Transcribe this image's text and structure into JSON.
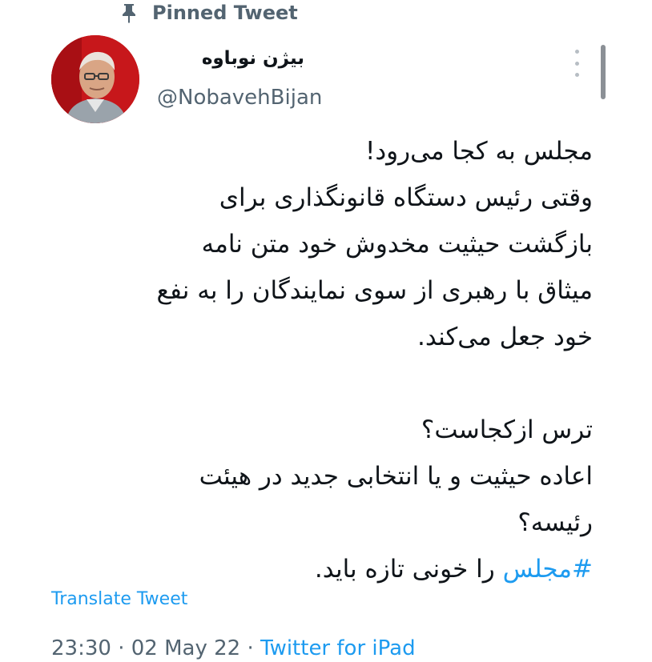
{
  "pinned": {
    "label": "Pinned Tweet"
  },
  "author": {
    "name": "بیژن نوباوه",
    "handle": "@NobavehBijan"
  },
  "tweet": {
    "lines_p1": [
      "مجلس به کجا می‌رود!",
      "وقتی رئیس دستگاه قانونگذاری برای",
      "بازگشت حیثیت مخدوش خود متن نامه",
      "میثاق با رهبری از سوی نمایندگان را به نفع",
      "خود جعل می‌کند."
    ],
    "lines_p2": [
      "ترس ازکجاست؟",
      "اعاده حیثیت و یا انتخابی جدید در هیئت",
      "رئیسه؟"
    ],
    "last_line": {
      "hashtag": "#مجلس",
      "rest": " را خونی تازه باید."
    }
  },
  "translate_label": "Translate Tweet",
  "meta": {
    "time": "23:30",
    "sep1": " · ",
    "date": "02 May 22",
    "sep2": " · ",
    "source": "Twitter for iPad"
  },
  "colors": {
    "link": "#1d9bf0",
    "muted": "#536471",
    "text": "#0f1419"
  }
}
